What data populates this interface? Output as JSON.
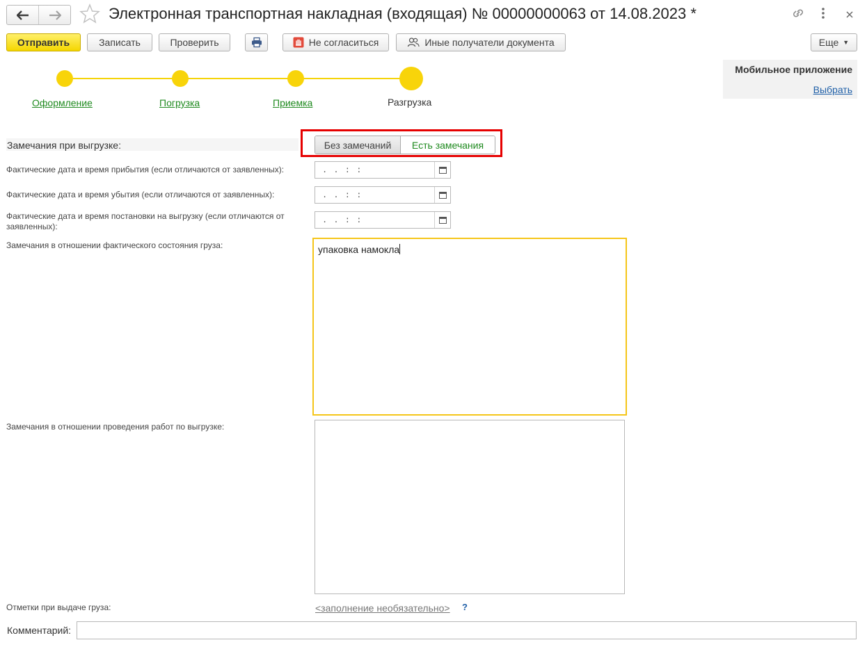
{
  "header": {
    "title": "Электронная транспортная накладная (входящая) № 00000000063 от 14.08.2023 *",
    "back_icon": "arrow-left",
    "forward_icon": "arrow-right",
    "favorite_icon": "star-outline",
    "link_icon": "chain-link",
    "more_icon": "vertical-dots",
    "close_icon": "close-x"
  },
  "toolbar": {
    "send_label": "Отправить",
    "save_label": "Записать",
    "check_label": "Проверить",
    "print_icon": "printer",
    "disagree_label": "Не согласиться",
    "disagree_icon": "stop-hand",
    "recipients_label": "Иные получатели документа",
    "recipients_icon": "users",
    "more_label": "Еще",
    "more_arrow": "▾"
  },
  "stepper": {
    "steps": [
      {
        "label": "Оформление",
        "state": "done"
      },
      {
        "label": "Погрузка",
        "state": "done"
      },
      {
        "label": "Приемка",
        "state": "done"
      },
      {
        "label": "Разгрузка",
        "state": "current"
      }
    ],
    "color": "#f8d40a"
  },
  "mobile": {
    "title": "Мобильное приложение",
    "select_label": "Выбрать"
  },
  "form": {
    "remarks_label": "Замечания при выгрузке:",
    "toggle": {
      "option_no": "Без замечаний",
      "option_yes": "Есть замечания",
      "selected": "Есть замечания"
    },
    "arrival_label": "Фактические дата и время прибытия (если отличаются от заявленных):",
    "departure_label": "Фактические дата и время убытия (если отличаются от заявленных):",
    "unloading_label": "Фактические дата и время постановки на выгрузку (если отличаются от заявленных):",
    "date_placeholder": " .  .      :  :",
    "cargo_remarks_label": "Замечания в отношении фактического состояния груза:",
    "cargo_remarks_value": "упаковка намокла",
    "work_remarks_label": "Замечания в отношении проведения работ по выгрузке:",
    "work_remarks_value": "",
    "marks_label": "Отметки при выдаче груза:",
    "marks_link": "<заполнение необязательно>",
    "help_label": "?",
    "comment_label": "Комментарий:",
    "comment_value": ""
  },
  "colors": {
    "accent_yellow": "#f4d600",
    "link_green": "#1f8a1f",
    "link_blue": "#2060a8",
    "highlight_red": "#e60000",
    "active_border": "#f5c518"
  }
}
